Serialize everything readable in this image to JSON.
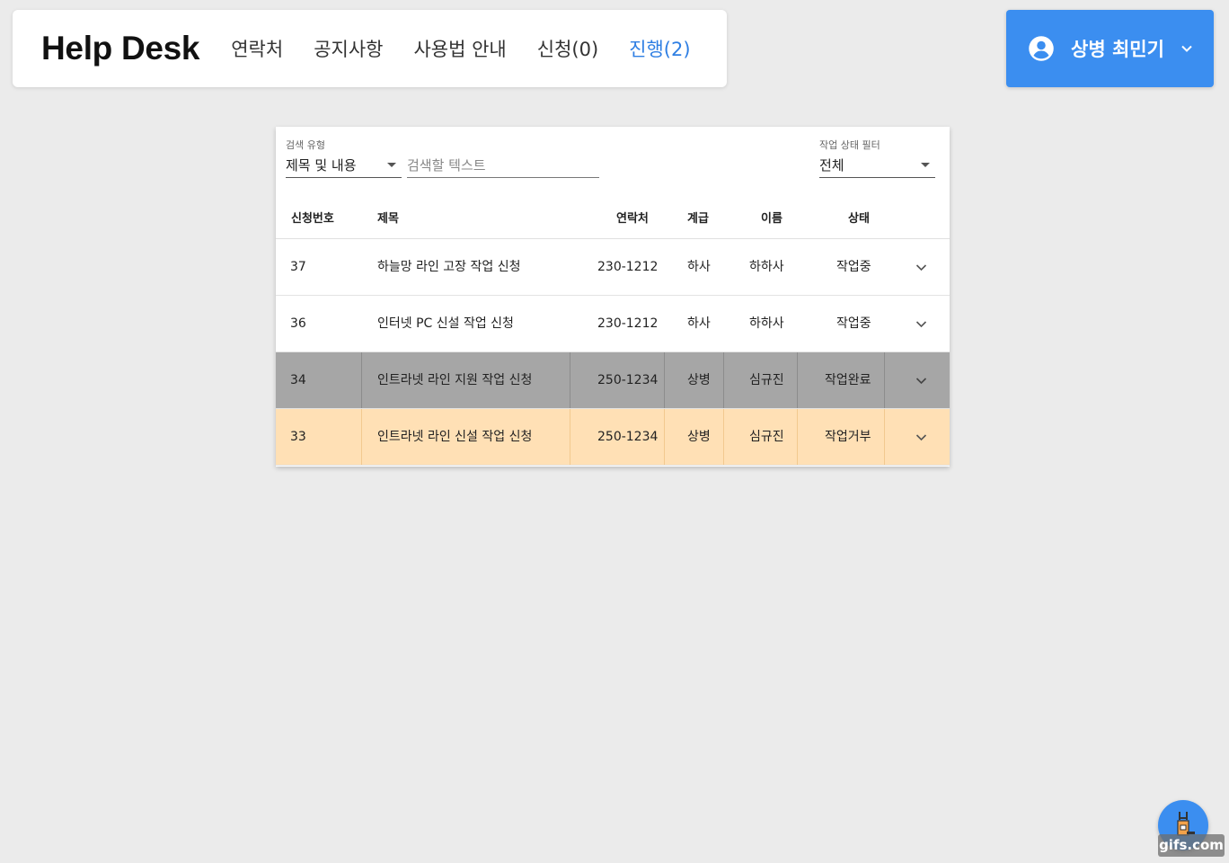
{
  "nav": {
    "brand": "Help Desk",
    "links": [
      {
        "label": "연락처"
      },
      {
        "label": "공지사항"
      },
      {
        "label": "사용법 안내"
      },
      {
        "label": "신청(0)"
      },
      {
        "label": "진행(2)"
      }
    ],
    "active_index": 4,
    "active_color": "#2f7fe3"
  },
  "user": {
    "name": "상병 최민기",
    "icon": "account-circle-icon",
    "bg_color": "#3b8ef0"
  },
  "filters": {
    "search_type_label": "검색 유형",
    "search_type_value": "제목 및 내용",
    "search_placeholder": "검색할 텍스트",
    "status_filter_label": "작업 상태 필터",
    "status_filter_value": "전체"
  },
  "table": {
    "headers": {
      "id": "신청번호",
      "title": "제목",
      "contact": "연락처",
      "rank": "계급",
      "name": "이름",
      "status": "상태"
    },
    "rows": [
      {
        "id": "37",
        "title": "하늘망 라인 고장 작업 신청",
        "contact": "230-1212",
        "rank": "하사",
        "name": "하하사",
        "status": "작업중",
        "highlight": "none"
      },
      {
        "id": "36",
        "title": "인터넷 PC 신설 작업 신청",
        "contact": "230-1212",
        "rank": "하사",
        "name": "하하사",
        "status": "작업중",
        "highlight": "none"
      },
      {
        "id": "34",
        "title": "인트라넷 라인 지원 작업 신청",
        "contact": "250-1234",
        "rank": "상병",
        "name": "심규진",
        "status": "작업완료",
        "highlight": "gray",
        "color": "#a6a6a6"
      },
      {
        "id": "33",
        "title": "인트라넷 라인 신설 작업 신청",
        "contact": "250-1234",
        "rank": "상병",
        "name": "심규진",
        "status": "작업거부",
        "highlight": "orange",
        "color": "#ffe0b5"
      }
    ]
  },
  "fab": {
    "icon": "repair-tool-icon"
  },
  "watermark": "gifs.com"
}
